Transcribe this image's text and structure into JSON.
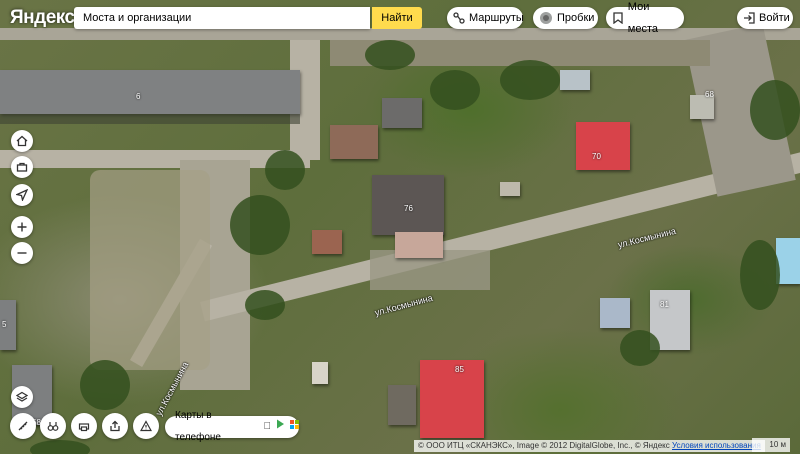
{
  "header": {
    "logo": "Яндекс",
    "search": {
      "value": "Моста и организации",
      "button_label": "Найти"
    },
    "routes_label": "Маршруты",
    "traffic_label": "Пробки",
    "my_places_label": "Мои места",
    "login_label": "Войти"
  },
  "map": {
    "streets": [
      "ул.Космынина",
      "ул.Космынина",
      "ул.Космынина"
    ],
    "house_numbers": [
      "6",
      "76",
      "70",
      "68",
      "81",
      "85",
      "5",
      "68"
    ]
  },
  "controls": {
    "left": [
      "home-icon",
      "briefcase-icon",
      "location-arrow-icon",
      "zoom-in-icon",
      "zoom-out-icon",
      "layers-icon"
    ],
    "bottom": [
      "ruler-icon",
      "binoculars-icon",
      "print-icon",
      "share-icon",
      "warning-icon"
    ]
  },
  "phone_banner": {
    "label": "Карты в телефоне"
  },
  "footer": {
    "copyright": "© ООО ИТЦ «СКАНЭКС», Image © 2012 DigitalGlobe, Inc., © Яндекс",
    "terms_label": "Условия использования",
    "scale_label": "10 м"
  },
  "colors": {
    "search_button": "#ffdb4d",
    "roof_red": "#d8434a",
    "link": "#0044bb"
  }
}
